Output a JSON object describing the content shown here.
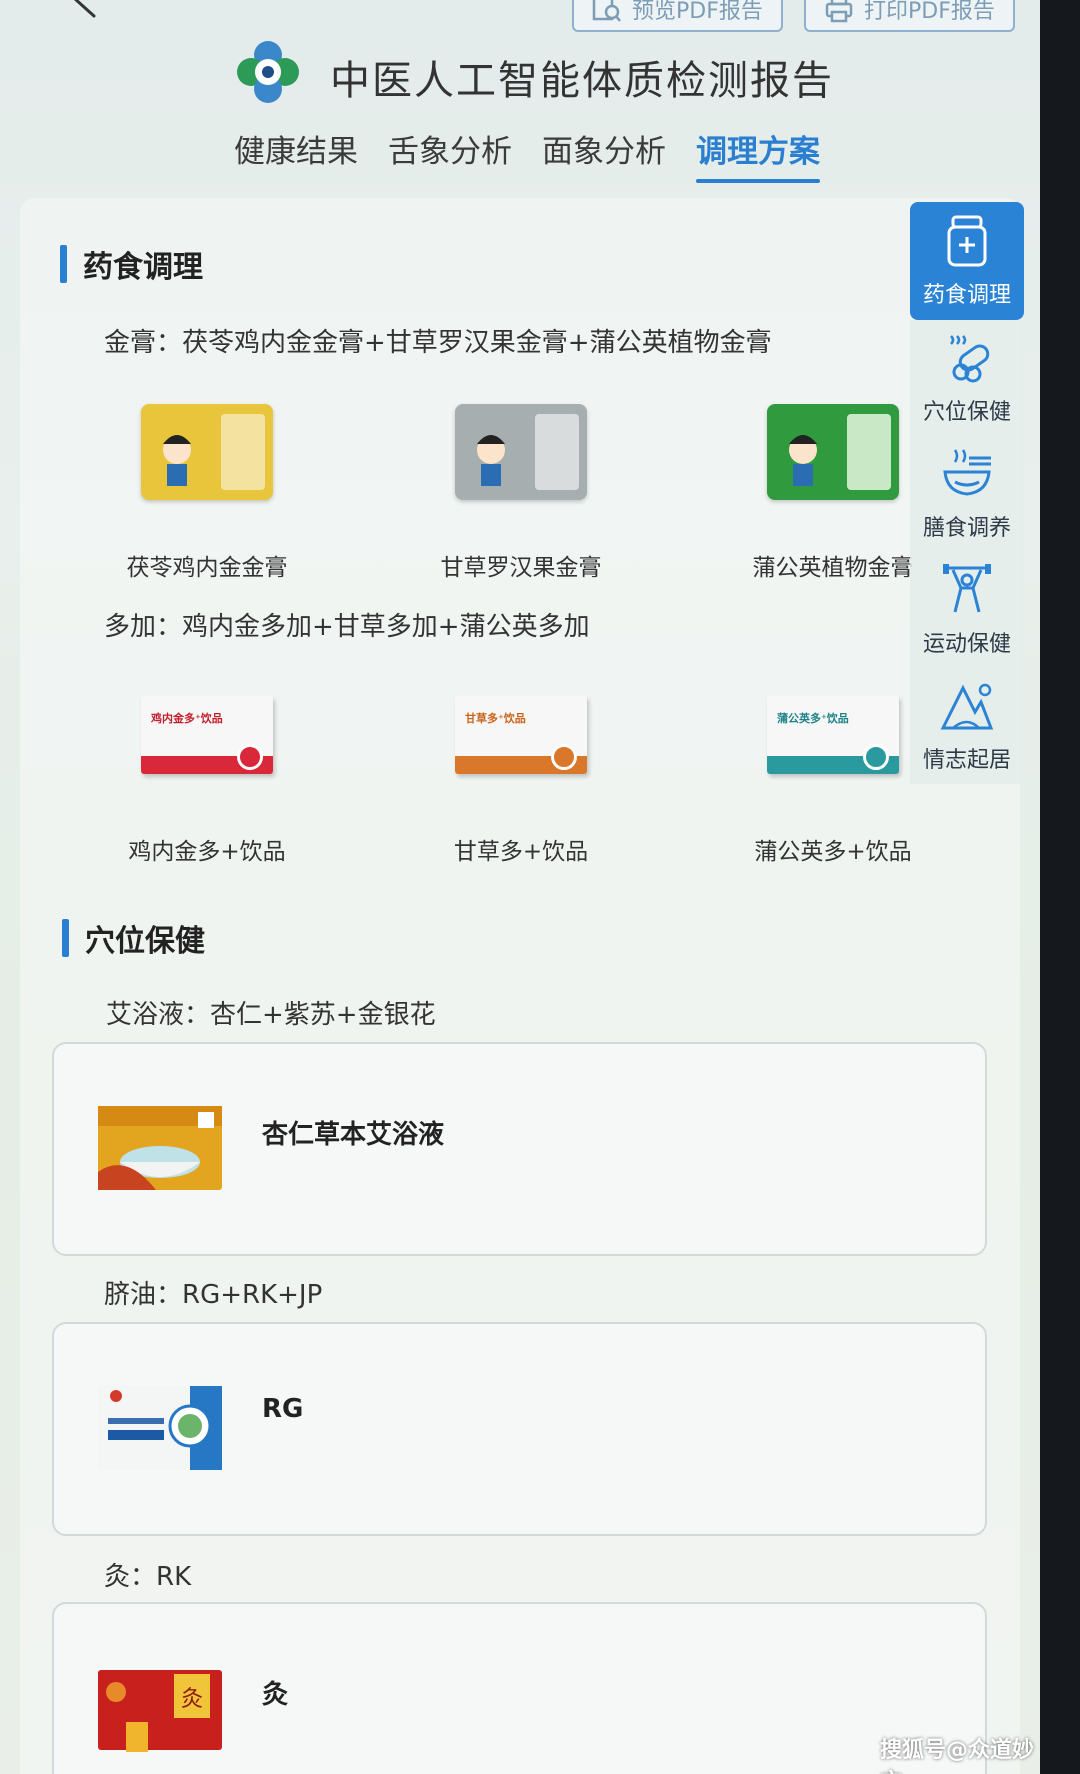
{
  "toolbar": {
    "preview_label": "预览PDF报告",
    "print_label": "打印PDF报告"
  },
  "header": {
    "title": "中医人工智能体质检测报告"
  },
  "tabs": [
    {
      "label": "健康结果"
    },
    {
      "label": "舌象分析"
    },
    {
      "label": "面象分析"
    },
    {
      "label": "调理方案"
    }
  ],
  "active_tab": "调理方案",
  "side_nav": [
    {
      "label": "药食调理",
      "icon": "medicine-bottle-icon"
    },
    {
      "label": "穴位保健",
      "icon": "moxa-icon"
    },
    {
      "label": "膳食调养",
      "icon": "bowl-icon"
    },
    {
      "label": "运动保健",
      "icon": "dumbbell-icon"
    },
    {
      "label": "情志起居",
      "icon": "mountain-icon"
    }
  ],
  "sections": {
    "diet": {
      "title": "药食调理",
      "paste_line": "金膏：茯苓鸡内金金膏+甘草罗汉果金膏+蒲公英植物金膏",
      "paste_products": [
        {
          "name": "茯苓鸡内金金膏",
          "color": "#e8c53a"
        },
        {
          "name": "甘草罗汉果金膏",
          "color": "#a7aeb0"
        },
        {
          "name": "蒲公英植物金膏",
          "color": "#2f9a3e"
        }
      ],
      "drink_line": "多加：鸡内金多加+甘草多加+蒲公英多加",
      "drink_products": [
        {
          "name": "鸡内金多+饮品",
          "box_text": "鸡内金多⁺饮品",
          "color": "#d8283a"
        },
        {
          "name": "甘草多+饮品",
          "box_text": "甘草多⁺饮品",
          "color": "#d9772a"
        },
        {
          "name": "蒲公英多+饮品",
          "box_text": "蒲公英多⁺饮品",
          "color": "#2a9a9f"
        }
      ]
    },
    "acupoint": {
      "title": "穴位保健",
      "bath_line": "艾浴液：杏仁+紫苏+金银花",
      "bath_product": "杏仁草本艾浴液",
      "navel_line": "脐油：RG+RK+JP",
      "navel_product": "RG",
      "moxa_line": "灸：RK",
      "moxa_product": "灸"
    }
  },
  "watermark": "搜狐号@众道妙方"
}
